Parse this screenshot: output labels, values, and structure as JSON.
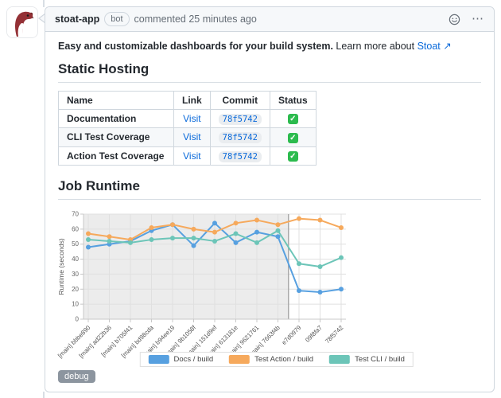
{
  "comment": {
    "author": "stoat-app",
    "author_badge": "bot",
    "action_text": "commented",
    "timestamp": "25 minutes ago",
    "intro_bold": "Easy and customizable dashboards for your build system.",
    "intro_regular": "Learn more about",
    "intro_link": "Stoat",
    "debug_label": "debug"
  },
  "icons": {
    "check": "✓",
    "kebab": "⋯",
    "external_arrow": "↗"
  },
  "sections": {
    "static_hosting_title": "Static Hosting",
    "job_runtime_title": "Job Runtime"
  },
  "table": {
    "headers": [
      "Name",
      "Link",
      "Commit",
      "Status"
    ],
    "rows": [
      {
        "name": "Documentation",
        "link": "Visit",
        "commit": "78f5742",
        "status": "check"
      },
      {
        "name": "CLI Test Coverage",
        "link": "Visit",
        "commit": "78f5742",
        "status": "check"
      },
      {
        "name": "Action Test Coverage",
        "link": "Visit",
        "commit": "78f5742",
        "status": "check"
      }
    ]
  },
  "chart_data": {
    "type": "line",
    "title": "Job Runtime",
    "xlabel": "",
    "ylabel": "Runtime (seconds)",
    "ylim": [
      0,
      70
    ],
    "yticks": [
      0,
      10,
      20,
      30,
      40,
      50,
      60,
      70
    ],
    "grid": true,
    "legend_position": "bottom",
    "x": [
      "[main] bbbe890",
      "[main] ad22b36",
      "[main] b705f41",
      "[main] bd98cda",
      "[main] b94ee19",
      "[main] 9b1058f",
      "[main] 151d9ef",
      "[main] 613181e",
      "[main] 9621761",
      "[main] 7663f4b",
      "e7d0979",
      "09f8fa7",
      "78f5742"
    ],
    "series": [
      {
        "name": "Docs / build",
        "color": "#57a0e0",
        "values": [
          48,
          50,
          52,
          59,
          63,
          49,
          64,
          51,
          58,
          55,
          19,
          18,
          20
        ]
      },
      {
        "name": "Test Action / build",
        "color": "#f6a95c",
        "values": [
          57,
          55,
          53,
          61,
          63,
          60,
          58,
          64,
          66,
          63,
          67,
          66,
          61
        ]
      },
      {
        "name": "Test CLI / build",
        "color": "#6cc5b8",
        "values": [
          53,
          52,
          51,
          53,
          54,
          54,
          52,
          57,
          51,
          59,
          37,
          35,
          41
        ]
      }
    ],
    "shaded_region": {
      "from_index": 0,
      "to_index": 9
    }
  },
  "colors": {
    "link_blue": "#0969da",
    "status_green": "#2cbb4e",
    "series_blue": "#57a0e0",
    "series_orange": "#f6a95c",
    "series_teal": "#6cc5b8"
  }
}
